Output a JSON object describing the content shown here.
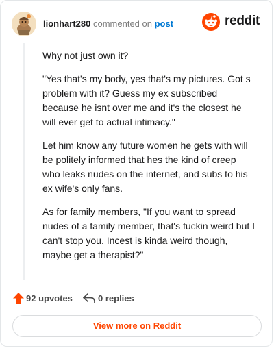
{
  "colors": {
    "accent": "#ff4500",
    "link": "#0079d3",
    "muted": "#7c7c7c"
  },
  "header": {
    "username": "lionhart280",
    "action_text": "commented on",
    "post_link": "post",
    "brand_name": "reddit",
    "brand_icon": "reddit-alien-icon",
    "avatar_icon": "avatar-icon"
  },
  "comment": {
    "paragraphs": [
      "Why not just own it?",
      "\"Yes that's my body, yes that's my pictures. Got s problem with it? Guess my ex subscribed because he isnt over me and it's the closest he will ever get to actual intimacy.\"",
      "Let him know any future women he gets with will be politely informed that hes the kind of creep who leaks nudes on the internet, and subs to his ex wife's only fans.",
      "As for family members, \"If you want to spread nudes of a family member, that's fuckin weird but I can't stop you. Incest is kinda weird though, maybe get a therapist?\""
    ]
  },
  "footer": {
    "upvotes": "92 upvotes",
    "upvote_icon": "upvote-arrow-icon",
    "replies": "0 replies",
    "reply_icon": "reply-arrow-icon",
    "view_more": "View more on Reddit"
  }
}
